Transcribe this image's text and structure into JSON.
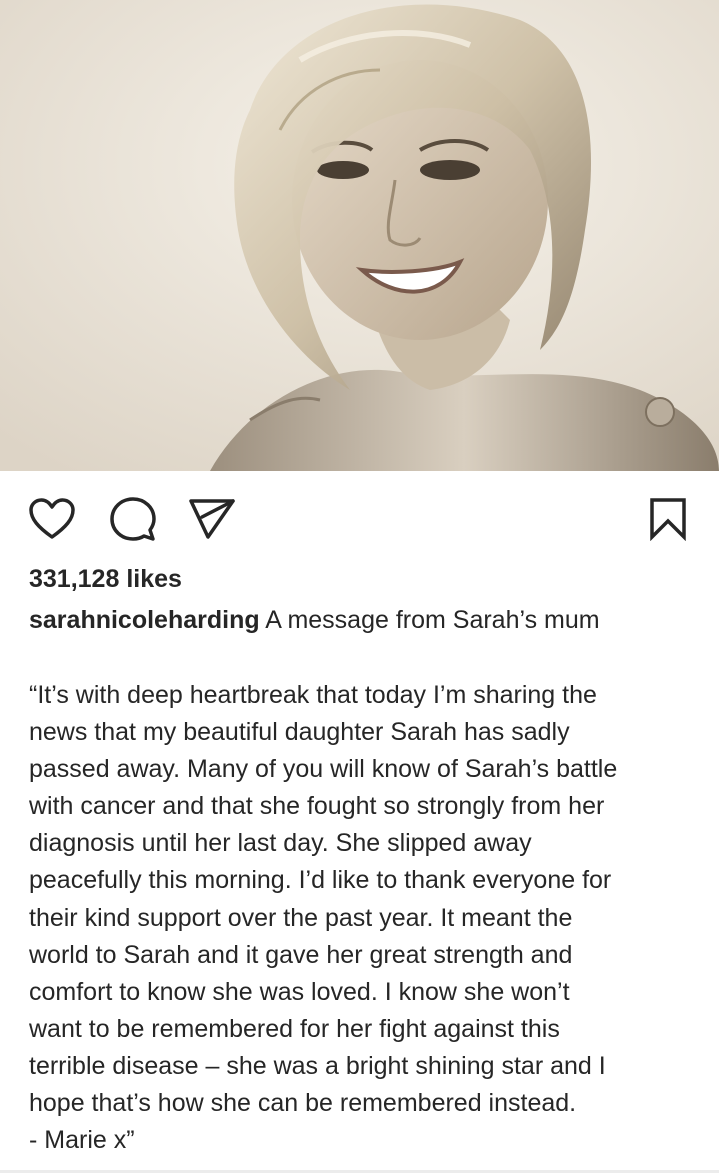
{
  "post": {
    "likes": "331,128 likes",
    "username": "sarahnicoleharding",
    "caption_intro": "A message from Sarah’s mum",
    "caption_lines": [
      "“It’s with deep heartbreak that today I’m sharing the",
      "news that my beautiful daughter Sarah has sadly",
      "passed away. Many of you will know of Sarah’s battle",
      "with cancer and that she fought so strongly from her",
      "diagnosis until her last day. She slipped away",
      "peacefully this morning. I’d like to thank everyone for",
      "their kind support over the past year. It meant the",
      "world to Sarah and it gave her great strength and",
      "comfort to know she was loved. I know she won’t",
      "want to be remembered for her fight against this",
      "terrible disease – she was a bright shining star and I",
      "hope that’s how she can be remembered instead.",
      "- Marie x”"
    ]
  },
  "actions": {
    "like_icon": "heart-icon",
    "comment_icon": "comment-icon",
    "share_icon": "send-icon",
    "save_icon": "bookmark-icon"
  },
  "colors": {
    "text": "#262626",
    "background": "#ffffff",
    "photo_tone": "#e9e2d6"
  }
}
